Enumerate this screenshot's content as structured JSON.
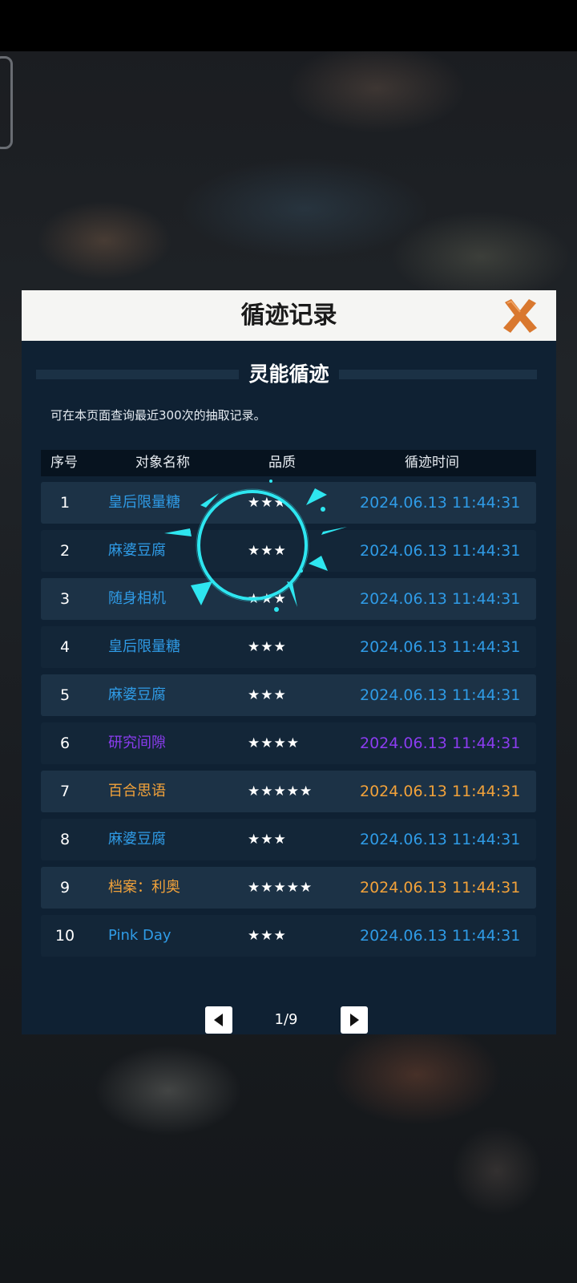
{
  "dialog": {
    "title": "循迹记录",
    "section_title": "灵能循迹",
    "hint": "可在本页面查询最近300次的抽取记录。"
  },
  "table": {
    "headers": [
      "序号",
      "对象名称",
      "品质",
      "循迹时间"
    ],
    "rows": [
      {
        "index": "1",
        "name": "皇后限量糖",
        "stars": "★★★",
        "date": "2024.06.13",
        "time": "11:44:31",
        "quality": "blue"
      },
      {
        "index": "2",
        "name": "麻婆豆腐",
        "stars": "★★★",
        "date": "2024.06.13",
        "time": "11:44:31",
        "quality": "blue"
      },
      {
        "index": "3",
        "name": "随身相机",
        "stars": "★★★",
        "date": "2024.06.13",
        "time": "11:44:31",
        "quality": "blue"
      },
      {
        "index": "4",
        "name": "皇后限量糖",
        "stars": "★★★",
        "date": "2024.06.13",
        "time": "11:44:31",
        "quality": "blue"
      },
      {
        "index": "5",
        "name": "麻婆豆腐",
        "stars": "★★★",
        "date": "2024.06.13",
        "time": "11:44:31",
        "quality": "blue"
      },
      {
        "index": "6",
        "name": "研究间隙",
        "stars": "★★★★",
        "date": "2024.06.13",
        "time": "11:44:31",
        "quality": "purple"
      },
      {
        "index": "7",
        "name": "百合思语",
        "stars": "★★★★★",
        "date": "2024.06.13",
        "time": "11:44:31",
        "quality": "gold"
      },
      {
        "index": "8",
        "name": "麻婆豆腐",
        "stars": "★★★",
        "date": "2024.06.13",
        "time": "11:44:31",
        "quality": "blue"
      },
      {
        "index": "9",
        "name": "档案：利奥",
        "stars": "★★★★★",
        "date": "2024.06.13",
        "time": "11:44:31",
        "quality": "gold"
      },
      {
        "index": "10",
        "name": "Pink Day",
        "stars": "★★★",
        "date": "2024.06.13",
        "time": "11:44:31",
        "quality": "blue"
      }
    ]
  },
  "pager": {
    "page": "1/9"
  },
  "icons": {
    "close": "close-icon",
    "prev": "triangle-left-icon",
    "next": "triangle-right-icon",
    "loading": "loading-spinner-icon"
  },
  "colors": {
    "blue": "#2f9be6",
    "purple": "#8b3cf0",
    "gold": "#f2a23a",
    "close_x": "#d9782f",
    "spinner": "#2ee6f0"
  }
}
